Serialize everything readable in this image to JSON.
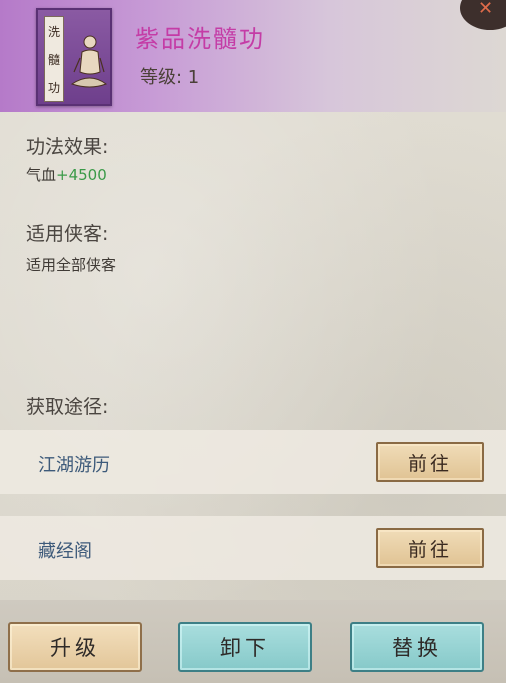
{
  "header": {
    "cover_chars": [
      "洗",
      "髓",
      "功"
    ],
    "title": "紫品洗髓功",
    "level": "等级: 1",
    "title_color": "#c43ca6"
  },
  "effect": {
    "label": "功法效果:",
    "stat_name": "气血",
    "stat_value": "+4500",
    "value_color": "#3a9a48"
  },
  "applicable": {
    "label": "适用侠客:",
    "text": "适用全部侠客"
  },
  "acquire": {
    "label": "获取途径:",
    "sources": [
      {
        "name": "江湖游历",
        "button": "前往"
      },
      {
        "name": "藏经阁",
        "button": "前往"
      }
    ]
  },
  "actions": {
    "upgrade": "升级",
    "unequip": "卸下",
    "replace": "替换"
  }
}
